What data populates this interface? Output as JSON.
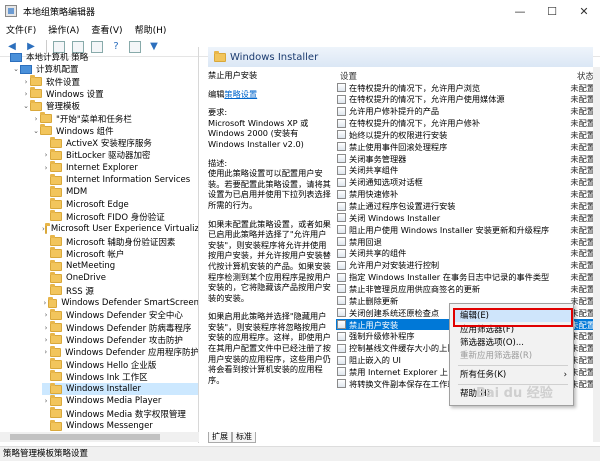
{
  "window": {
    "title": "本地组策略编辑器",
    "controls": [
      "—",
      "☐",
      "✕"
    ]
  },
  "menubar": [
    "文件(F)",
    "操作(A)",
    "查看(V)",
    "帮助(H)"
  ],
  "tree": [
    {
      "label": "本地计算机 策略",
      "icon": "pc",
      "level": 0,
      "arrow": ""
    },
    {
      "label": "计算机配置",
      "icon": "pc",
      "level": 1,
      "arrow": "v"
    },
    {
      "label": "软件设置",
      "icon": "folder",
      "level": 2,
      "arrow": ">"
    },
    {
      "label": "Windows 设置",
      "icon": "folder",
      "level": 2,
      "arrow": ">"
    },
    {
      "label": "管理模板",
      "icon": "folder",
      "level": 2,
      "arrow": "v"
    },
    {
      "label": "\"开始\"菜单和任务栏",
      "icon": "folder",
      "level": 3,
      "arrow": ">"
    },
    {
      "label": "Windows 组件",
      "icon": "folder",
      "level": 3,
      "arrow": "v"
    },
    {
      "label": "ActiveX 安装程序服务",
      "icon": "folder",
      "level": 4,
      "arrow": ""
    },
    {
      "label": "BitLocker 驱动器加密",
      "icon": "folder",
      "level": 4,
      "arrow": ">"
    },
    {
      "label": "Internet Explorer",
      "icon": "folder",
      "level": 4,
      "arrow": ">"
    },
    {
      "label": "Internet Information Services",
      "icon": "folder",
      "level": 4,
      "arrow": ""
    },
    {
      "label": "MDM",
      "icon": "folder",
      "level": 4,
      "arrow": ""
    },
    {
      "label": "Microsoft Edge",
      "icon": "folder",
      "level": 4,
      "arrow": ""
    },
    {
      "label": "Microsoft FIDO 身份验证",
      "icon": "folder",
      "level": 4,
      "arrow": ""
    },
    {
      "label": "Microsoft User Experience Virtualiz",
      "icon": "folder",
      "level": 4,
      "arrow": ">"
    },
    {
      "label": "Microsoft 辅助身份验证因素",
      "icon": "folder",
      "level": 4,
      "arrow": ""
    },
    {
      "label": "Microsoft 帐户",
      "icon": "folder",
      "level": 4,
      "arrow": ""
    },
    {
      "label": "NetMeeting",
      "icon": "folder",
      "level": 4,
      "arrow": ""
    },
    {
      "label": "OneDrive",
      "icon": "folder",
      "level": 4,
      "arrow": ""
    },
    {
      "label": "RSS 源",
      "icon": "folder",
      "level": 4,
      "arrow": ""
    },
    {
      "label": "Windows Defender SmartScreen",
      "icon": "folder",
      "level": 4,
      "arrow": ">"
    },
    {
      "label": "Windows Defender 安全中心",
      "icon": "folder",
      "level": 4,
      "arrow": ">"
    },
    {
      "label": "Windows Defender 防病毒程序",
      "icon": "folder",
      "level": 4,
      "arrow": ">"
    },
    {
      "label": "Windows Defender 攻击防护",
      "icon": "folder",
      "level": 4,
      "arrow": ">"
    },
    {
      "label": "Windows Defender 应用程序防护",
      "icon": "folder",
      "level": 4,
      "arrow": ">"
    },
    {
      "label": "Windows Hello 企业版",
      "icon": "folder",
      "level": 4,
      "arrow": ""
    },
    {
      "label": "Windows Ink 工作区",
      "icon": "folder",
      "level": 4,
      "arrow": ""
    },
    {
      "label": "Windows Installer",
      "icon": "folder",
      "level": 4,
      "arrow": "",
      "selected": true
    },
    {
      "label": "Windows Media Player",
      "icon": "folder",
      "level": 4,
      "arrow": ">"
    },
    {
      "label": "Windows Media 数字权限管理",
      "icon": "folder",
      "level": 4,
      "arrow": ""
    },
    {
      "label": "Windows Messenger",
      "icon": "folder",
      "level": 4,
      "arrow": ""
    }
  ],
  "header": {
    "title": "Windows Installer"
  },
  "desc": {
    "title": "禁止用户安装",
    "edit_prefix": "编辑",
    "edit_link": "策略设置",
    "req_label": "要求:",
    "req_text": "Microsoft Windows XP 或 Windows 2000 (安装有 Windows Installer v2.0)",
    "desc_label": "描述:",
    "p1": "使用此策略设置可以配置用户安装。若要配置此策略设置，请将其设置为已启用并使用下拉列表选择所需的行为。",
    "p2": "如果未配置此策略设置，或者如果已启用此策略并选择了\"允许用户安装\"，则安装程序将允许并使用按用户安装，并允许按用户安装替代按计算机安装的产品。如果安装程序检测到某个应用程序是按用户安装的，它将隐藏该产品按用户安装的安装。",
    "p3": "如果启用此策略并选择\"隐藏用户安装\"，则安装程序将忽略按用户安装的应用程序。这样，即使用户在其用户配置文件中已经注册了按用户安装的应用程序，这些用户仍将会看到按计算机安装的应用程序。"
  },
  "columns": {
    "setting": "设置",
    "state": "状态"
  },
  "settings": [
    {
      "name": "在特权提升的情况下，允许用户浏览",
      "state": "未配置"
    },
    {
      "name": "在特权提升的情况下，允许用户使用媒体源",
      "state": "未配置"
    },
    {
      "name": "允许用户修补提升的产品",
      "state": "未配置"
    },
    {
      "name": "在特权提升的情况下，允许用户修补",
      "state": "未配置"
    },
    {
      "name": "始终以提升的权限进行安装",
      "state": "未配置"
    },
    {
      "name": "禁止使用事件回滚处理程序",
      "state": "未配置"
    },
    {
      "name": "关闭事务管理器",
      "state": "未配置"
    },
    {
      "name": "关闭共享组件",
      "state": "未配置"
    },
    {
      "name": "关闭通知选项对话框",
      "state": "未配置"
    },
    {
      "name": "禁用快速修补",
      "state": "未配置"
    },
    {
      "name": "禁止通过程序包设置进行安装",
      "state": "未配置"
    },
    {
      "name": "关闭 Windows Installer",
      "state": "未配置"
    },
    {
      "name": "阻止用户使用 Windows Installer 安装更新和升级程序",
      "state": "未配置"
    },
    {
      "name": "禁用回退",
      "state": "未配置"
    },
    {
      "name": "关闭共享的组件",
      "state": "未配置"
    },
    {
      "name": "允许用户对安装进行控制",
      "state": "未配置"
    },
    {
      "name": "指定 Windows Installer 在事务日志中记录的事件类型",
      "state": "未配置"
    },
    {
      "name": "禁止非管理员应用供应商签名的更新",
      "state": "未配置"
    },
    {
      "name": "禁止删除更新",
      "state": "未配置"
    },
    {
      "name": "关闭创建系统还原检查点",
      "state": "未配置"
    },
    {
      "name": "禁止用户安装",
      "state": "未配置",
      "selected": true
    },
    {
      "name": "强制升级修补程序",
      "state": "未配置"
    },
    {
      "name": "控制基线文件缓存大小的上限",
      "state": "未配置"
    },
    {
      "name": "阻止嵌入的 UI",
      "state": "未配置"
    },
    {
      "name": "禁用 Internet Explorer 上 Wi",
      "state": "未配置"
    },
    {
      "name": "将转换文件副本保存在工作站上",
      "state": "未配置"
    }
  ],
  "context_menu": {
    "items": [
      {
        "label": "编辑(E)",
        "disabled": false,
        "highlight": true
      },
      {
        "label": "应用筛选器(F)",
        "disabled": false
      },
      {
        "label": "筛选器选项(O)...",
        "disabled": false
      },
      {
        "label": "重新应用筛选器(R)",
        "disabled": true
      },
      {
        "label": "所有任务(K)",
        "disabled": false,
        "submenu": true
      },
      {
        "label": "帮助(H)",
        "disabled": false
      }
    ]
  },
  "tabs": [
    "扩展",
    "标准"
  ],
  "status": "策略管理模板策略设置",
  "watermark": "Bai du 经验"
}
